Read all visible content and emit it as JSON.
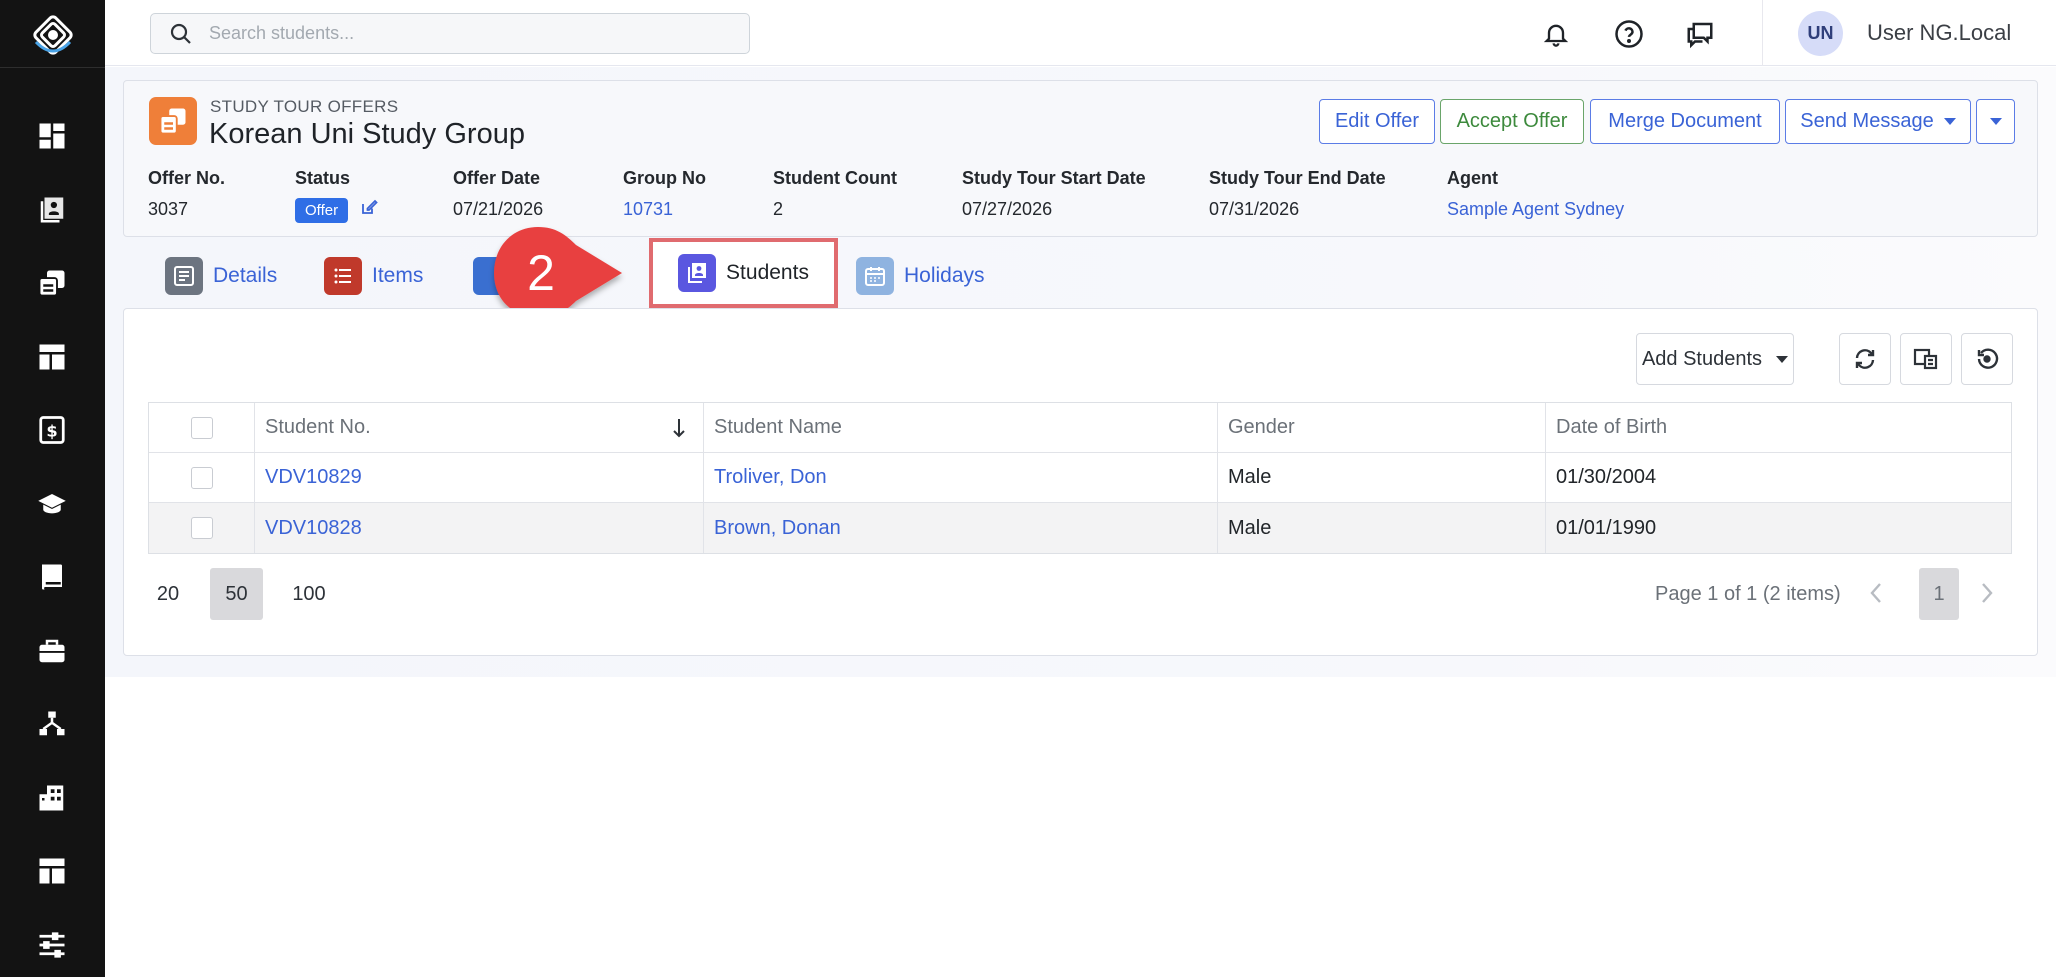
{
  "topbar": {
    "search_placeholder": "Search students...",
    "avatar_initials": "UN",
    "username": "User NG.Local"
  },
  "offer": {
    "category": "STUDY TOUR OFFERS",
    "title": "Korean Uni Study Group",
    "buttons": {
      "edit": "Edit Offer",
      "accept": "Accept Offer",
      "merge": "Merge Document",
      "send": "Send Message"
    },
    "fields": [
      {
        "label": "Offer No.",
        "value": "3037"
      },
      {
        "label": "Status",
        "value": "Offer"
      },
      {
        "label": "Offer Date",
        "value": "07/21/2026"
      },
      {
        "label": "Group No",
        "value": "10731"
      },
      {
        "label": "Student Count",
        "value": "2"
      },
      {
        "label": "Study Tour Start Date",
        "value": "07/27/2026"
      },
      {
        "label": "Study Tour End Date",
        "value": "07/31/2026"
      },
      {
        "label": "Agent",
        "value": "Sample Agent Sydney"
      }
    ]
  },
  "tabs": {
    "details": "Details",
    "items": "Items",
    "students": "Students",
    "holidays": "Holidays",
    "callout_number": "2"
  },
  "students_panel": {
    "add_button": "Add Students",
    "columns": [
      "Student No.",
      "Student Name",
      "Gender",
      "Date of Birth"
    ],
    "rows": [
      {
        "student_no": "VDV10829",
        "name": "Troliver, Don",
        "gender": "Male",
        "dob": "01/30/2004"
      },
      {
        "student_no": "VDV10828",
        "name": "Brown, Donan",
        "gender": "Male",
        "dob": "01/01/1990"
      }
    ],
    "page_sizes": [
      "20",
      "50",
      "100"
    ],
    "selected_page_size": "50",
    "page_info": "Page 1 of 1 (2 items)",
    "current_page": "1"
  },
  "colors": {
    "sidebar": "#131313",
    "accent": "#3a63d6",
    "callout": "#e8403f",
    "offer_icon": "#ef7f39"
  }
}
